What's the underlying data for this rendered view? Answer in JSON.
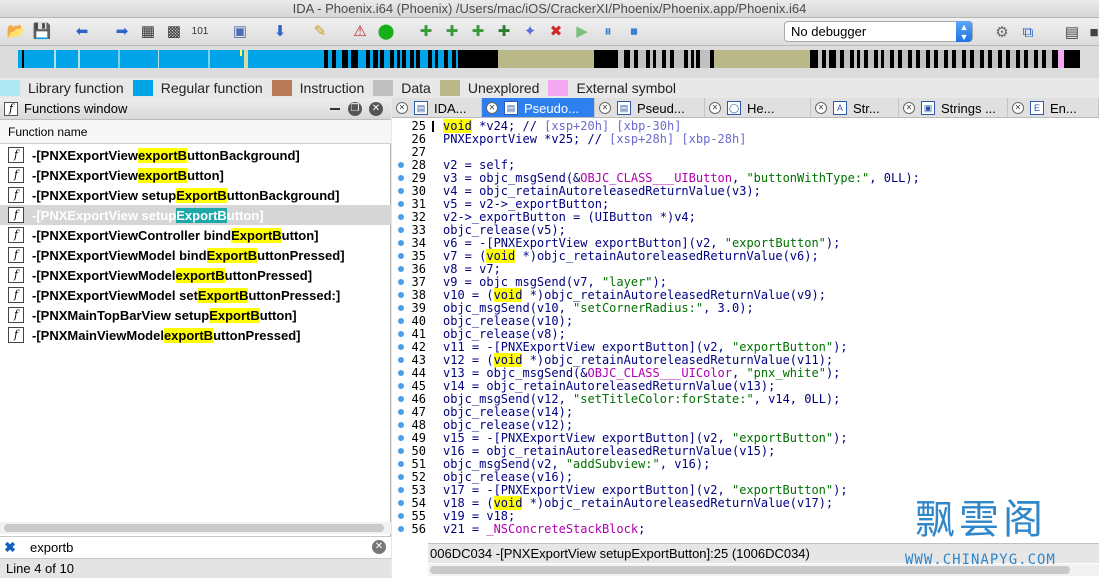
{
  "window_title": "IDA - Phoenix.i64 (Phoenix) /Users/mac/iOS/CrackerXI/Phoenix/Phoenix.app/Phoenix.i64",
  "toolbar": {
    "debugger_select": "No debugger",
    "icons": [
      "open-icon",
      "save-icon",
      "back-icon",
      "forward-icon",
      "type-icon",
      "data-icon",
      "binary-icon",
      "struct-icon",
      "enum-icon",
      "jump-icon",
      "xref-icon",
      "warning-icon",
      "run-green-icon",
      "add-func-icon",
      "add-struct-icon",
      "add-enum-icon",
      "add-segment-icon",
      "edit-func-icon",
      "delete-icon",
      "play-icon",
      "pause-icon",
      "stop-icon",
      "debugger-icon",
      "attach-icon",
      "help-icon",
      "exit-icon"
    ]
  },
  "legend": [
    {
      "label": "Library function",
      "color": "#aee8f5"
    },
    {
      "label": "Regular function",
      "color": "#00a4e8"
    },
    {
      "label": "Instruction",
      "color": "#b87c58"
    },
    {
      "label": "Data",
      "color": "#c0c0c0"
    },
    {
      "label": "Unexplored",
      "color": "#b8b888"
    },
    {
      "label": "External symbol",
      "color": "#f4a8f4"
    }
  ],
  "functions_window": {
    "title": "Functions window",
    "column_header": "Function name",
    "items": [
      {
        "pre": "-[PNXExportView ",
        "match": "exportB",
        "post": "uttonBackground]",
        "selected": false
      },
      {
        "pre": "-[PNXExportView ",
        "match": "exportB",
        "post": "utton]",
        "selected": false
      },
      {
        "pre": "-[PNXExportView setup",
        "match": "ExportB",
        "post": "uttonBackground]",
        "selected": false
      },
      {
        "pre": "-[PNXExportView setup",
        "match": "ExportB",
        "post": "utton]",
        "selected": true
      },
      {
        "pre": "-[PNXExportViewController bind",
        "match": "ExportB",
        "post": "utton]",
        "selected": false
      },
      {
        "pre": "-[PNXExportViewModel bind",
        "match": "ExportB",
        "post": "uttonPressed]",
        "selected": false
      },
      {
        "pre": "-[PNXExportViewModel ",
        "match": "exportB",
        "post": "uttonPressed]",
        "selected": false
      },
      {
        "pre": "-[PNXExportViewModel set",
        "match": "ExportB",
        "post": "uttonPressed:]",
        "selected": false
      },
      {
        "pre": "-[PNXMainTopBarView setup",
        "match": "ExportB",
        "post": "utton]",
        "selected": false
      },
      {
        "pre": "-[PNXMainViewModel ",
        "match": "exportB",
        "post": "uttonPressed]",
        "selected": false
      }
    ],
    "search_value": "exportb",
    "status": "Line 4 of 10"
  },
  "tabs": [
    {
      "label": "IDA...",
      "icon": "ida-view-icon",
      "active": false
    },
    {
      "label": "Pseudo...",
      "icon": "pseudocode-icon",
      "active": true
    },
    {
      "label": "Pseud...",
      "icon": "pseudocode-icon",
      "active": false
    },
    {
      "label": "He...",
      "icon": "hex-icon",
      "active": false
    },
    {
      "label": "Str...",
      "icon": "structures-icon",
      "active": false
    },
    {
      "label": "Strings ...",
      "icon": "strings-icon",
      "active": false
    },
    {
      "label": "En...",
      "icon": "enums-icon",
      "active": false
    }
  ],
  "code_lines": [
    {
      "n": "25",
      "dot": false,
      "parts": [
        [
          "kw",
          "void"
        ],
        [
          "t",
          " *v24; // "
        ],
        [
          "cmt",
          "[xsp+20h] [xbp-30h]"
        ]
      ]
    },
    {
      "n": "26",
      "dot": false,
      "parts": [
        [
          "t",
          "PNXExportView *v25; // "
        ],
        [
          "cmt",
          "[xsp+28h] [xbp-28h]"
        ]
      ]
    },
    {
      "n": "27",
      "dot": false,
      "parts": []
    },
    {
      "n": "28",
      "dot": true,
      "parts": [
        [
          "t",
          "v2 = self;"
        ]
      ]
    },
    {
      "n": "29",
      "dot": true,
      "parts": [
        [
          "t",
          "v3 = objc_msgSend(&"
        ],
        [
          "glb",
          "OBJC_CLASS___UIButton"
        ],
        [
          "t",
          ", "
        ],
        [
          "str",
          "\"buttonWithType:\""
        ],
        [
          "t",
          ", 0LL);"
        ]
      ]
    },
    {
      "n": "30",
      "dot": true,
      "parts": [
        [
          "t",
          "v4 = objc_retainAutoreleasedReturnValue(v3);"
        ]
      ]
    },
    {
      "n": "31",
      "dot": true,
      "parts": [
        [
          "t",
          "v5 = v2->_exportButton;"
        ]
      ]
    },
    {
      "n": "32",
      "dot": true,
      "parts": [
        [
          "t",
          "v2->_exportButton = (UIButton *)v4;"
        ]
      ]
    },
    {
      "n": "33",
      "dot": true,
      "parts": [
        [
          "t",
          "objc_release(v5);"
        ]
      ]
    },
    {
      "n": "34",
      "dot": true,
      "parts": [
        [
          "t",
          "v6 = -[PNXExportView exportButton](v2, "
        ],
        [
          "str",
          "\"exportButton\""
        ],
        [
          "t",
          ");"
        ]
      ]
    },
    {
      "n": "35",
      "dot": true,
      "parts": [
        [
          "t",
          "v7 = ("
        ],
        [
          "kw",
          "void"
        ],
        [
          "t",
          " *)objc_retainAutoreleasedReturnValue(v6);"
        ]
      ]
    },
    {
      "n": "36",
      "dot": true,
      "parts": [
        [
          "t",
          "v8 = v7;"
        ]
      ]
    },
    {
      "n": "37",
      "dot": true,
      "parts": [
        [
          "t",
          "v9 = objc_msgSend(v7, "
        ],
        [
          "str",
          "\"layer\""
        ],
        [
          "t",
          ");"
        ]
      ]
    },
    {
      "n": "38",
      "dot": true,
      "parts": [
        [
          "t",
          "v10 = ("
        ],
        [
          "kw",
          "void"
        ],
        [
          "t",
          " *)objc_retainAutoreleasedReturnValue(v9);"
        ]
      ]
    },
    {
      "n": "39",
      "dot": true,
      "parts": [
        [
          "t",
          "objc_msgSend(v10, "
        ],
        [
          "str",
          "\"setCornerRadius:\""
        ],
        [
          "t",
          ", 3.0);"
        ]
      ]
    },
    {
      "n": "40",
      "dot": true,
      "parts": [
        [
          "t",
          "objc_release(v10);"
        ]
      ]
    },
    {
      "n": "41",
      "dot": true,
      "parts": [
        [
          "t",
          "objc_release(v8);"
        ]
      ]
    },
    {
      "n": "42",
      "dot": true,
      "parts": [
        [
          "t",
          "v11 = -[PNXExportView exportButton](v2, "
        ],
        [
          "str",
          "\"exportButton\""
        ],
        [
          "t",
          ");"
        ]
      ]
    },
    {
      "n": "43",
      "dot": true,
      "parts": [
        [
          "t",
          "v12 = ("
        ],
        [
          "kw",
          "void"
        ],
        [
          "t",
          " *)objc_retainAutoreleasedReturnValue(v11);"
        ]
      ]
    },
    {
      "n": "44",
      "dot": true,
      "parts": [
        [
          "t",
          "v13 = objc_msgSend(&"
        ],
        [
          "glb",
          "OBJC_CLASS___UIColor"
        ],
        [
          "t",
          ", "
        ],
        [
          "str",
          "\"pnx_white\""
        ],
        [
          "t",
          ");"
        ]
      ]
    },
    {
      "n": "45",
      "dot": true,
      "parts": [
        [
          "t",
          "v14 = objc_retainAutoreleasedReturnValue(v13);"
        ]
      ]
    },
    {
      "n": "46",
      "dot": true,
      "parts": [
        [
          "t",
          "objc_msgSend(v12, "
        ],
        [
          "str",
          "\"setTitleColor:forState:\""
        ],
        [
          "t",
          ", v14, 0LL);"
        ]
      ]
    },
    {
      "n": "47",
      "dot": true,
      "parts": [
        [
          "t",
          "objc_release(v14);"
        ]
      ]
    },
    {
      "n": "48",
      "dot": true,
      "parts": [
        [
          "t",
          "objc_release(v12);"
        ]
      ]
    },
    {
      "n": "49",
      "dot": true,
      "parts": [
        [
          "t",
          "v15 = -[PNXExportView exportButton](v2, "
        ],
        [
          "str",
          "\"exportButton\""
        ],
        [
          "t",
          ");"
        ]
      ]
    },
    {
      "n": "50",
      "dot": true,
      "parts": [
        [
          "t",
          "v16 = objc_retainAutoreleasedReturnValue(v15);"
        ]
      ]
    },
    {
      "n": "51",
      "dot": true,
      "parts": [
        [
          "t",
          "objc_msgSend(v2, "
        ],
        [
          "str",
          "\"addSubview:\""
        ],
        [
          "t",
          ", v16);"
        ]
      ]
    },
    {
      "n": "52",
      "dot": true,
      "parts": [
        [
          "t",
          "objc_release(v16);"
        ]
      ]
    },
    {
      "n": "53",
      "dot": true,
      "parts": [
        [
          "t",
          "v17 = -[PNXExportView exportButton](v2, "
        ],
        [
          "str",
          "\"exportButton\""
        ],
        [
          "t",
          ");"
        ]
      ]
    },
    {
      "n": "54",
      "dot": true,
      "parts": [
        [
          "t",
          "v18 = ("
        ],
        [
          "kw",
          "void"
        ],
        [
          "t",
          " *)objc_retainAutoreleasedReturnValue(v17);"
        ]
      ]
    },
    {
      "n": "55",
      "dot": true,
      "parts": [
        [
          "t",
          "v19 = v18;"
        ]
      ]
    },
    {
      "n": "56",
      "dot": true,
      "parts": [
        [
          "t",
          "v21 = "
        ],
        [
          "glb",
          "_NSConcreteStackBlock"
        ],
        [
          "t",
          ";"
        ]
      ]
    }
  ],
  "code_status": "006DC034 -[PNXExportView setupExportButton]:25 (1006DC034)",
  "watermark": {
    "cn": "飘雲阁",
    "url": "WWW.CHINAPYG.COM"
  }
}
